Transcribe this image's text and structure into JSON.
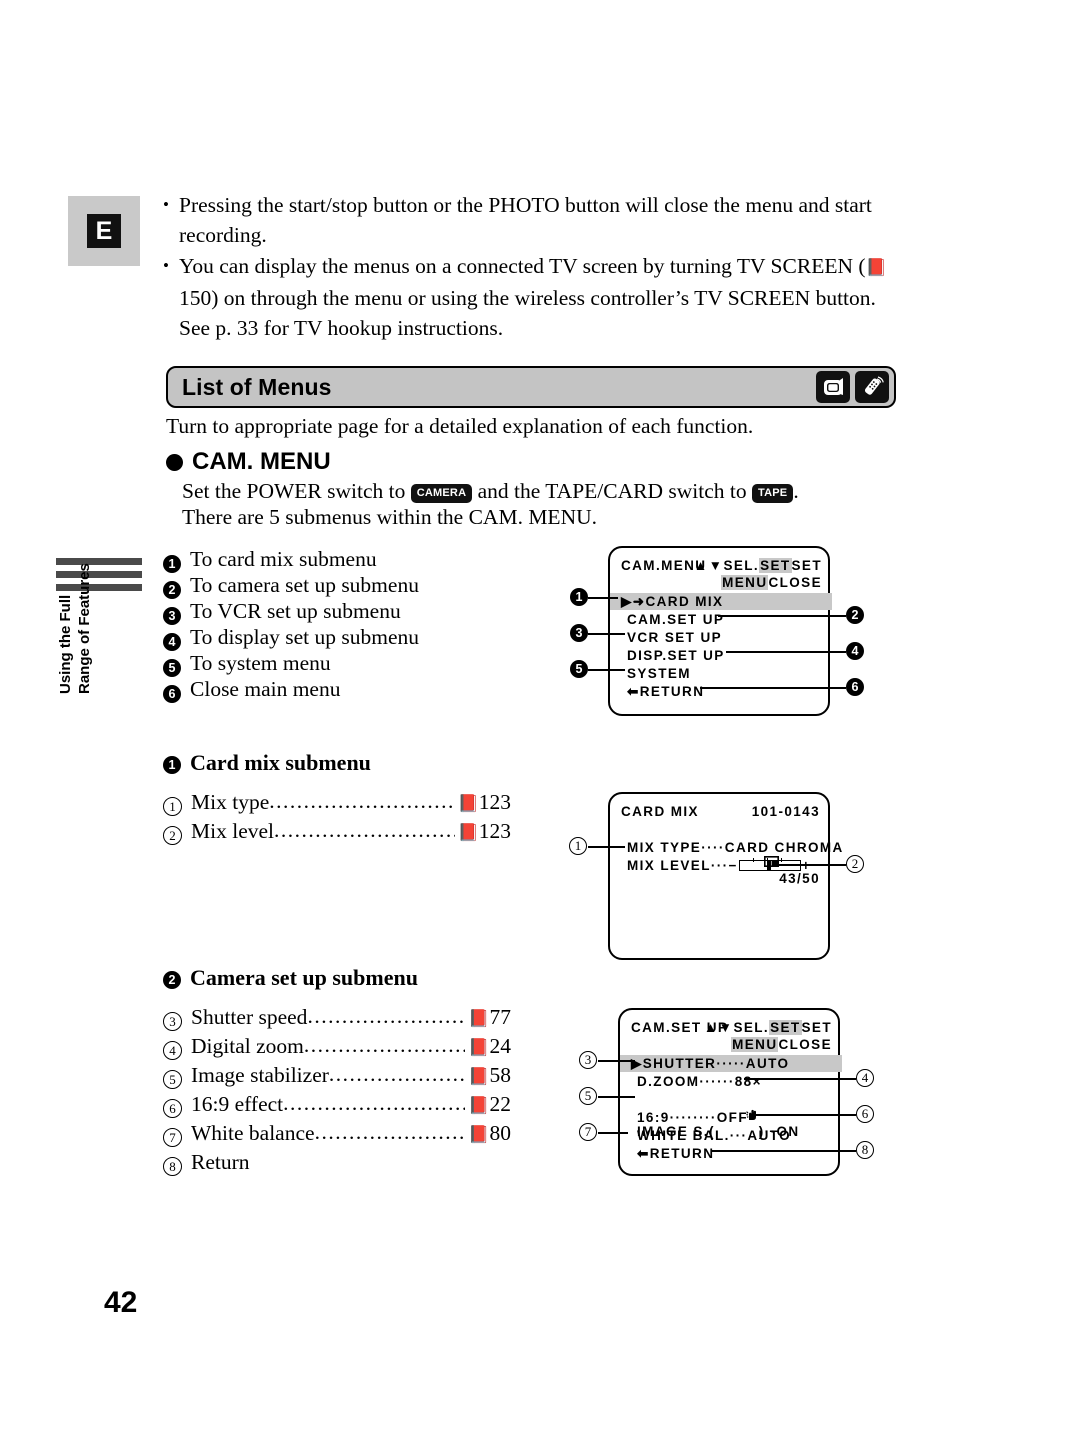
{
  "page": {
    "number": "42",
    "language_tab": "E",
    "side_tab_line1": "Using the Full",
    "side_tab_line2": "Range of Features"
  },
  "intro": {
    "bullet_char": "•",
    "bullets": [
      "Pressing the start/stop button or the PHOTO button will close the menu and start recording.",
      "You can display the menus on a connected TV screen by turning TV SCREEN (—150) on through the menu or using the wireless controller’s TV SCREEN button. See p. 33 for TV hookup instructions."
    ],
    "bullet2_part1": "You can display the menus on a connected TV screen by turning TV SCREEN",
    "bullet2_part2_pre": "(",
    "bullet2_page": "150",
    "bullet2_part2_post": ") on through the menu or using the wireless controller’s TV SCREEN",
    "bullet2_part3": "button. See p. 33 for TV hookup instructions."
  },
  "section": {
    "title": "List of Menus",
    "icon1": "camcorder-icon",
    "icon2": "wireless-controller-icon"
  },
  "lead_in": {
    "turn_to_line": "Turn to appropriate page for a detailed explanation of each function.",
    "cam_menu_heading": "CAM. MENU",
    "set_power_pre": "Set the POWER switch to",
    "key_camera": "CAMERA",
    "set_power_mid": "and the TAPE/CARD switch to",
    "key_tape": "TAPE",
    "set_power_post": ".",
    "submenu_count_line": "There are 5 submenus within the CAM. MENU."
  },
  "main_menu_list": [
    {
      "num": "1",
      "text": "To card mix submenu"
    },
    {
      "num": "2",
      "text": "To camera set up submenu"
    },
    {
      "num": "3",
      "text": "To VCR set up submenu"
    },
    {
      "num": "4",
      "text": "To display set up submenu"
    },
    {
      "num": "5",
      "text": "To system menu"
    },
    {
      "num": "6",
      "text": "Close main menu"
    }
  ],
  "lcd_cam_menu": {
    "title": "CAM.MENU",
    "hint_sel": "▲▼SEL.",
    "hint_set": "SET",
    "hint_set2": "SET",
    "hint_menu": "MENU",
    "hint_close": "CLOSE",
    "items": [
      "▶➜CARD MIX",
      "CAM.SET UP",
      "VCR SET UP",
      "DISP.SET UP",
      "SYSTEM",
      "⬅RETURN"
    ],
    "callouts": [
      "1",
      "2",
      "3",
      "4",
      "5",
      "6"
    ]
  },
  "card_mix_section": {
    "heading_num": "1",
    "heading": "Card mix submenu",
    "rows": [
      {
        "num": "1",
        "label": "Mix type",
        "page": "123"
      },
      {
        "num": "2",
        "label": "Mix level",
        "page": "123"
      }
    ]
  },
  "lcd_card_mix": {
    "title": "CARD MIX",
    "file_no": "101-0143",
    "card_icon": "memory-card-icon",
    "counter": "43/50",
    "row1_label": "MIX TYPE····",
    "row1_value": "CARD CHROMA",
    "row2_label": "MIX LEVEL···",
    "row2_minus": "−",
    "row2_plus": "+",
    "callouts": [
      "1",
      "2"
    ]
  },
  "camera_setup_section": {
    "heading_num": "2",
    "heading": "Camera set up submenu",
    "rows": [
      {
        "num": "3",
        "label": "Shutter speed",
        "page": "77"
      },
      {
        "num": "4",
        "label": "Digital zoom",
        "page": "24"
      },
      {
        "num": "5",
        "label": "Image stabilizer",
        "page": "58"
      },
      {
        "num": "6",
        "label": "16:9 effect",
        "page": "22"
      },
      {
        "num": "7",
        "label": "White balance",
        "page": "80"
      },
      {
        "num": "8",
        "label": "Return",
        "page": ""
      }
    ]
  },
  "lcd_cam_setup": {
    "title": "CAM.SET UP",
    "hint_sel": "▲▼SEL.",
    "hint_set": "SET",
    "hint_set2": "SET",
    "hint_menu": "MENU",
    "hint_close": "CLOSE",
    "items": [
      "▶SHUTTER·····AUTO",
      "D.ZOOM······88×",
      "16:9········OFF",
      "WHITE BAL.···AUTO",
      "⬅RETURN"
    ],
    "image_s_pre": "IMAGE S.(",
    "image_s_icon": "hand-shake-icon",
    "image_s_post": ")··ON",
    "callouts": [
      "3",
      "4",
      "5",
      "6",
      "7",
      "8"
    ]
  },
  "colors": {
    "bar_gray": "#c4c4c4",
    "tab_gray": "#c9c9c9",
    "highlight_gray": "#c8c8c8",
    "rule_dark": "#4a4a4a"
  }
}
